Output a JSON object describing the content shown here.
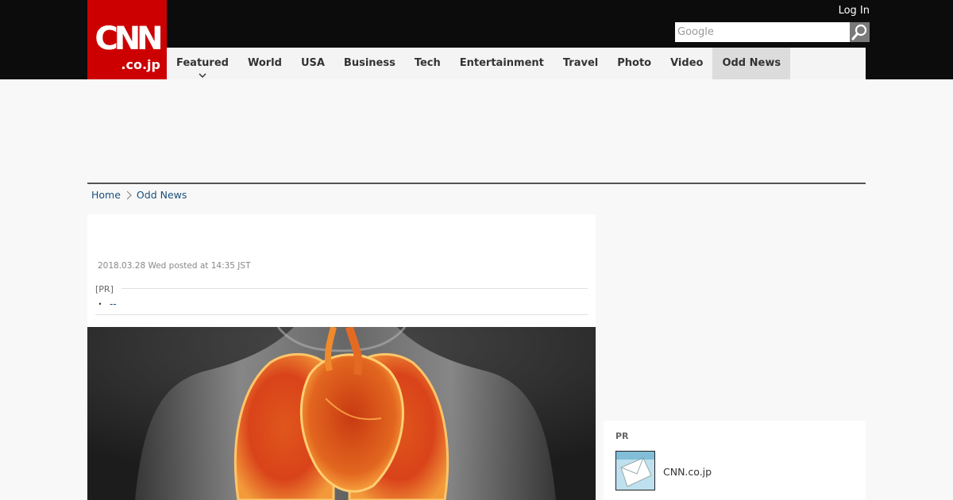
{
  "header": {
    "logo_main": "CNN",
    "logo_sub": ".co.jp",
    "login_label": "Log In",
    "search_placeholder": "Google",
    "search_icon": "search-icon"
  },
  "nav": {
    "items": [
      {
        "label": "Featured"
      },
      {
        "label": "World"
      },
      {
        "label": "USA"
      },
      {
        "label": "Business"
      },
      {
        "label": "Tech"
      },
      {
        "label": "Entertainment"
      },
      {
        "label": "Travel"
      },
      {
        "label": "Photo"
      },
      {
        "label": "Video"
      },
      {
        "label": "Odd News"
      }
    ],
    "active": "Odd News"
  },
  "breadcrumb": {
    "home": "Home",
    "current": "Odd News"
  },
  "article": {
    "posted": "2018.03.28 Wed posted at 14:35 JST",
    "pr_label": "[PR]",
    "pr_link_bullet": "・",
    "pr_link_text": "--"
  },
  "sidebar": {
    "pr_label": "PR",
    "item_text": "CNN.co.jp"
  },
  "colors": {
    "brand": "#cc0000",
    "topbar": "#0c0c0c",
    "link": "#1a4f7a"
  }
}
